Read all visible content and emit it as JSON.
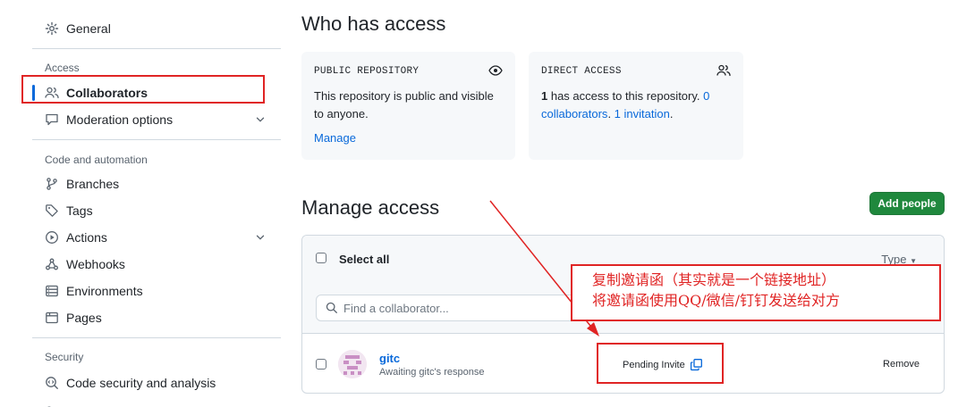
{
  "sidebar": {
    "general": "General",
    "sections": {
      "access": "Access",
      "code_automation": "Code and automation",
      "security": "Security"
    },
    "items": {
      "collaborators": "Collaborators",
      "moderation": "Moderation options",
      "branches": "Branches",
      "tags": "Tags",
      "actions": "Actions",
      "webhooks": "Webhooks",
      "environments": "Environments",
      "pages": "Pages",
      "code_security": "Code security and analysis"
    }
  },
  "who_has_access": {
    "title": "Who has access",
    "public_card": {
      "caption": "PUBLIC REPOSITORY",
      "text": "This repository is public and visible to anyone.",
      "link": "Manage"
    },
    "direct_card": {
      "caption": "DIRECT ACCESS",
      "count": "1",
      "text": " has access to this repository. ",
      "link_collaborators": "0 collaborators",
      "separator": ". ",
      "link_invitation": "1 invitation",
      "end": "."
    }
  },
  "manage_access": {
    "title": "Manage access",
    "add_button": "Add people",
    "select_all": "Select all",
    "type_filter": "Type",
    "search_placeholder": "Find a collaborator...",
    "rows": [
      {
        "name": "gitc",
        "status": "Awaiting gitc's response",
        "pending": "Pending Invite",
        "remove": "Remove"
      }
    ]
  },
  "annotation": {
    "line1": "复制邀请函（其实就是一个链接地址）",
    "line2": "将邀请函使用QQ/微信/钉钉发送给对方",
    "color": "#e02424"
  },
  "colors": {
    "accent": "#0969da",
    "primary_button": "#1f883d",
    "annotation": "#e02424"
  }
}
